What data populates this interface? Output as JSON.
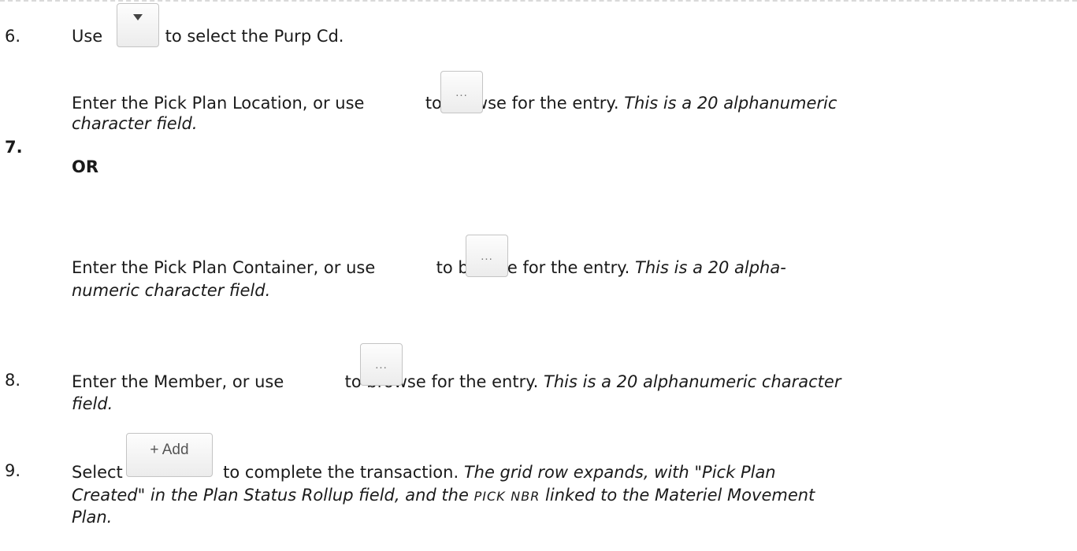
{
  "steps": {
    "s6": {
      "num": "6.",
      "pre": "Use",
      "post": "to select the Purp Cd."
    },
    "s7": {
      "num": "7.",
      "a_pre": "Enter the Pick Plan Location, or use",
      "a_post": "to browse for the entry.",
      "a_italic1": "This is a 20 alphanumeric",
      "a_italic2": "character field.",
      "or": "OR",
      "b_pre": "Enter the Pick Plan Container, or use",
      "b_post": "to browse for the entry.",
      "b_italic1": "This is a 20 alpha-",
      "b_italic2": "numeric character field."
    },
    "s8": {
      "num": "8.",
      "pre": "Enter the Member, or use",
      "post": "to browse for the entry.",
      "italic1": "This is a 20 alphanumeric character",
      "italic2": "field."
    },
    "s9": {
      "num": "9.",
      "pre": "Select",
      "post": "to complete the transaction.",
      "italic1": "The grid row expands, with \"Pick Plan",
      "l2_a": "Created\" in the Plan Status Rollup field, and the",
      "l2_sc1": "PICK",
      "l2_sc2": "NBR",
      "l2_b": "linked to the Materiel Movement",
      "l3": "Plan."
    }
  },
  "buttons": {
    "browse_label": "...",
    "add_label": "+ Add",
    "select_icon": "dropdown-triangle-icon"
  }
}
